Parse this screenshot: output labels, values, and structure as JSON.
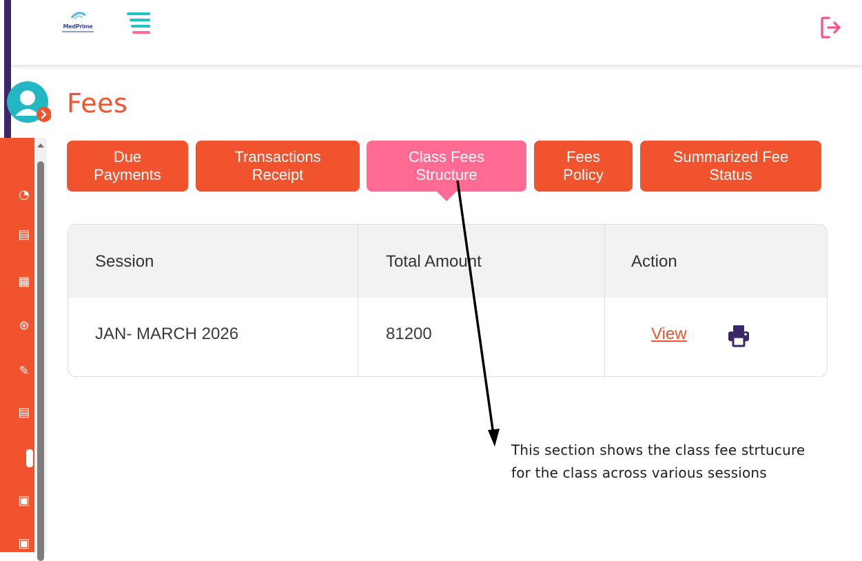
{
  "header": {
    "logo_text": "MedPrime",
    "logout_label": ""
  },
  "page": {
    "title": "Fees"
  },
  "tabs": [
    {
      "label": "Due\nPayments",
      "active": false
    },
    {
      "label": "Transactions\nReceipt",
      "active": false
    },
    {
      "label": "Class Fees\nStructure",
      "active": true
    },
    {
      "label": "Fees\nPolicy",
      "active": false
    },
    {
      "label": "Summarized Fee\nStatus",
      "active": false
    }
  ],
  "table": {
    "headers": [
      "Session",
      "Total Amount",
      "Action"
    ],
    "rows": [
      {
        "session": "JAN- MARCH 2026",
        "total_amount": "81200",
        "action_link": "View"
      }
    ]
  },
  "sidebar": {
    "icons": [
      "dashboard-icon",
      "report-icon",
      "document-icon",
      "settings-icon",
      "magic-icon",
      "report-icon",
      "calendar-icon",
      "calendar-icon"
    ]
  },
  "annotation": {
    "text": "This section shows the class fee strtucure\nfor the class across various sessions"
  },
  "colors": {
    "accent": "#f0532e",
    "active_tab": "#ff6b93",
    "sidebar_edge": "#3b2667",
    "print_icon": "#3b2667"
  }
}
